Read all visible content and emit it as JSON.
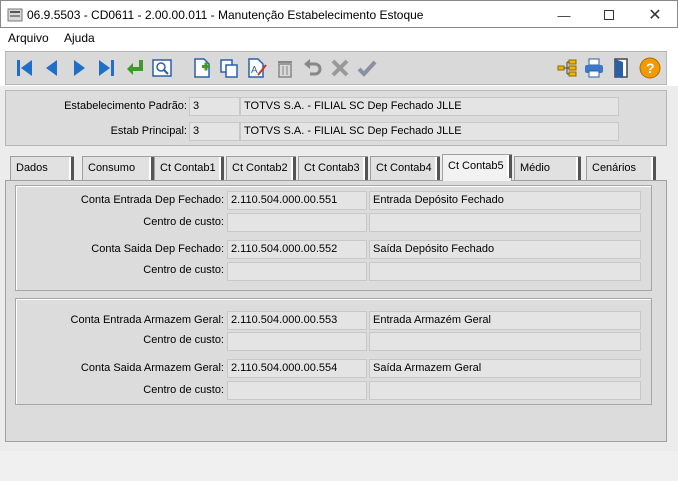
{
  "window": {
    "title": "06.9.5503 - CD0611 - 2.00.00.011 - Manutenção Estabelecimento Estoque"
  },
  "menu": {
    "arquivo": "Arquivo",
    "ajuda": "Ajuda"
  },
  "toolbar": {
    "icons": [
      "first-record-icon",
      "previous-record-icon",
      "next-record-icon",
      "last-record-icon",
      "goto-icon",
      "search-icon",
      "new-icon",
      "copy-icon",
      "edit-icon",
      "delete-icon",
      "undo-icon",
      "cancel-icon",
      "confirm-icon",
      "tree-icon",
      "print-icon",
      "exit-icon",
      "help-icon"
    ]
  },
  "header": {
    "estab_padrao": {
      "label": "Estabelecimento Padrão:",
      "code": "3",
      "name": "TOTVS S.A.  - FILIAL SC Dep Fechado JLLE"
    },
    "estab_principal": {
      "label": "Estab Principal:",
      "code": "3",
      "name": "TOTVS S.A.  - FILIAL SC Dep Fechado JLLE"
    }
  },
  "tabs": [
    "Dados",
    "Consumo",
    "Ct Contab1",
    "Ct Contab2",
    "Ct Contab3",
    "Ct Contab4",
    "Ct Contab5",
    "Médio",
    "Cenários"
  ],
  "active_tab": "Ct Contab5",
  "group1": {
    "entrada": {
      "label": "Conta Entrada Dep Fechado:",
      "account": "2.110.504.000.00.551",
      "desc": "Entrada Depósito Fechado"
    },
    "entrada_cc": {
      "label": "Centro de custo:",
      "account": "",
      "desc": ""
    },
    "saida": {
      "label": "Conta Saida Dep Fechado:",
      "account": "2.110.504.000.00.552",
      "desc": "Saída Depósito Fechado"
    },
    "saida_cc": {
      "label": "Centro de custo:",
      "account": "",
      "desc": ""
    }
  },
  "group2": {
    "entrada": {
      "label": "Conta Entrada Armazem Geral:",
      "account": "2.110.504.000.00.553",
      "desc": "Entrada Armazém Geral"
    },
    "entrada_cc": {
      "label": "Centro de custo:",
      "account": "",
      "desc": ""
    },
    "saida": {
      "label": "Conta Saida Armazem Geral:",
      "account": "2.110.504.000.00.554",
      "desc": "Saída Armazem Geral"
    },
    "saida_cc": {
      "label": "Centro de custo:",
      "account": "",
      "desc": ""
    }
  }
}
